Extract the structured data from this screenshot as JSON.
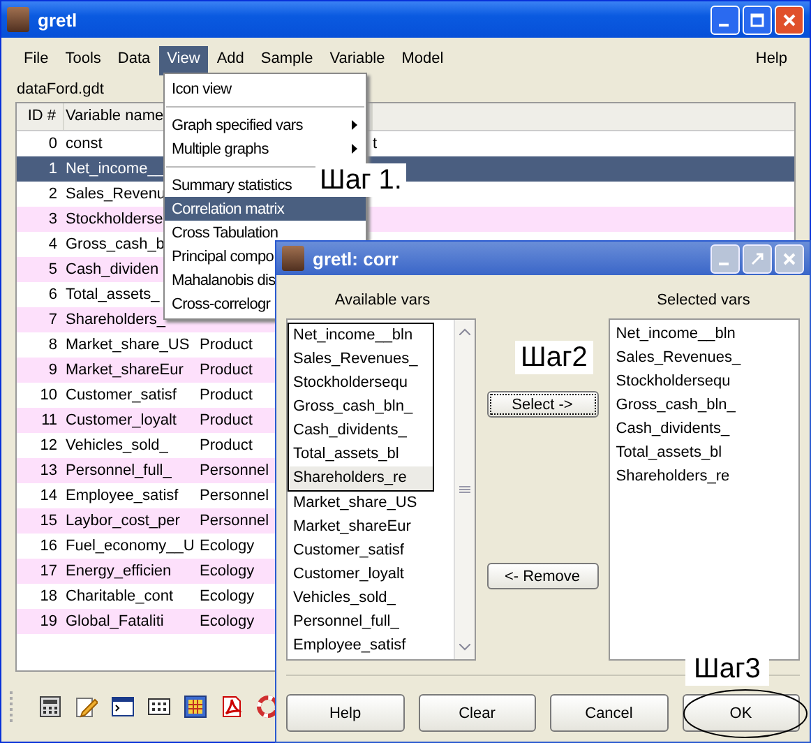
{
  "main_window": {
    "title": "gretl",
    "menu": [
      {
        "label": "File",
        "selected": false
      },
      {
        "label": "Tools",
        "selected": false
      },
      {
        "label": "Data",
        "selected": false
      },
      {
        "label": "View",
        "selected": true
      },
      {
        "label": "Add",
        "selected": false
      },
      {
        "label": "Sample",
        "selected": false
      },
      {
        "label": "Variable",
        "selected": false
      },
      {
        "label": "Model",
        "selected": false
      }
    ],
    "menu_right": [
      {
        "label": "Help",
        "selected": false
      }
    ],
    "filename": "dataFord.gdt",
    "table": {
      "columns": [
        "ID #",
        "Variable name"
      ],
      "rows": [
        {
          "id": "0",
          "name": "const",
          "column_4": "t",
          "selected": false
        },
        {
          "id": "1",
          "name": "Net_income__",
          "selected": true
        },
        {
          "id": "2",
          "name": "Sales_Revenu",
          "selected": false
        },
        {
          "id": "3",
          "name": "Stockholderse",
          "selected": false
        },
        {
          "id": "4",
          "name": "Gross_cash_b",
          "selected": false
        },
        {
          "id": "5",
          "name": "Cash_dividen",
          "selected": false
        },
        {
          "id": "6",
          "name": "Total_assets_",
          "selected": false
        },
        {
          "id": "7",
          "name": "Shareholders_",
          "selected": false
        },
        {
          "id": "8",
          "name": "Market_share_US",
          "column_3": "Product",
          "selected": false
        },
        {
          "id": "9",
          "name": "Market_shareEur",
          "column_3": "Product",
          "selected": false
        },
        {
          "id": "10",
          "name": "Customer_satisf",
          "column_3": "Product",
          "selected": false
        },
        {
          "id": "11",
          "name": "Customer_loyalt",
          "column_3": "Product",
          "selected": false
        },
        {
          "id": "12",
          "name": "Vehicles_sold_",
          "column_3": "Product",
          "selected": false
        },
        {
          "id": "13",
          "name": "Personnel_full_",
          "column_3": "Personnel",
          "selected": false
        },
        {
          "id": "14",
          "name": "Employee_satisf",
          "column_3": "Personnel",
          "selected": false
        },
        {
          "id": "15",
          "name": "Laybor_cost_per",
          "column_3": "Personnel",
          "selected": false
        },
        {
          "id": "16",
          "name": "Fuel_economy__U",
          "column_3": "Ecology",
          "selected": false
        },
        {
          "id": "17",
          "name": "Energy_efficien",
          "column_3": "Ecology",
          "selected": false
        },
        {
          "id": "18",
          "name": "Charitable_cont",
          "column_3": "Ecology",
          "selected": false
        },
        {
          "id": "19",
          "name": "Global_Fataliti",
          "column_3": "Ecology",
          "selected": false
        }
      ]
    }
  },
  "view_menu": {
    "items": [
      {
        "kind": "item",
        "label": "Icon view",
        "selected": false
      },
      {
        "kind": "separator"
      },
      {
        "kind": "submenu",
        "label": "Graph specified vars",
        "selected": false
      },
      {
        "kind": "submenu",
        "label": "Multiple graphs",
        "selected": false
      },
      {
        "kind": "separator"
      },
      {
        "kind": "item",
        "label": "Summary statistics",
        "selected": false
      },
      {
        "kind": "item",
        "label": "Correlation matrix",
        "selected": true
      },
      {
        "kind": "item",
        "label": "Cross Tabulation",
        "selected": false
      },
      {
        "kind": "item",
        "label": "Principal compo",
        "selected": false
      },
      {
        "kind": "item",
        "label": "Mahalanobis dis",
        "selected": false
      },
      {
        "kind": "item",
        "label": "Cross-correlogr",
        "selected": false
      }
    ]
  },
  "dialog": {
    "title": "gretl: corr",
    "available_label": "Available vars",
    "selected_label": "Selected vars",
    "available": [
      {
        "label": "Net_income__bln",
        "framed": true,
        "selected": false
      },
      {
        "label": "Sales_Revenues_",
        "framed": true,
        "selected": false
      },
      {
        "label": "Stockholdersequ",
        "framed": true,
        "selected": false
      },
      {
        "label": "Gross_cash_bln_",
        "framed": true,
        "selected": false
      },
      {
        "label": "Cash_dividents_",
        "framed": true,
        "selected": false
      },
      {
        "label": "Total_assets_bl",
        "framed": true,
        "selected": false
      },
      {
        "label": "Shareholders_re",
        "framed": true,
        "selected": true
      },
      {
        "label": "Market_share_US",
        "framed": false,
        "selected": false
      },
      {
        "label": "Market_shareEur",
        "framed": false,
        "selected": false
      },
      {
        "label": "Customer_satisf",
        "framed": false,
        "selected": false
      },
      {
        "label": "Customer_loyalt",
        "framed": false,
        "selected": false
      },
      {
        "label": "Vehicles_sold_",
        "framed": false,
        "selected": false
      },
      {
        "label": "Personnel_full_",
        "framed": false,
        "selected": false
      },
      {
        "label": "Employee_satisf",
        "framed": false,
        "selected": false
      }
    ],
    "selected": [
      "Net_income__bln",
      "Sales_Revenues_",
      "Stockholdersequ",
      "Gross_cash_bln_",
      "Cash_dividents_",
      "Total_assets_bl",
      "Shareholders_re"
    ],
    "select_button": "Select ->",
    "remove_button": "<- Remove",
    "buttons": [
      "Help",
      "Clear",
      "Cancel",
      "OK"
    ]
  },
  "annotations": {
    "step1": "Шаг 1.",
    "step2": "Шаг2",
    "step3": "Шаг3"
  }
}
